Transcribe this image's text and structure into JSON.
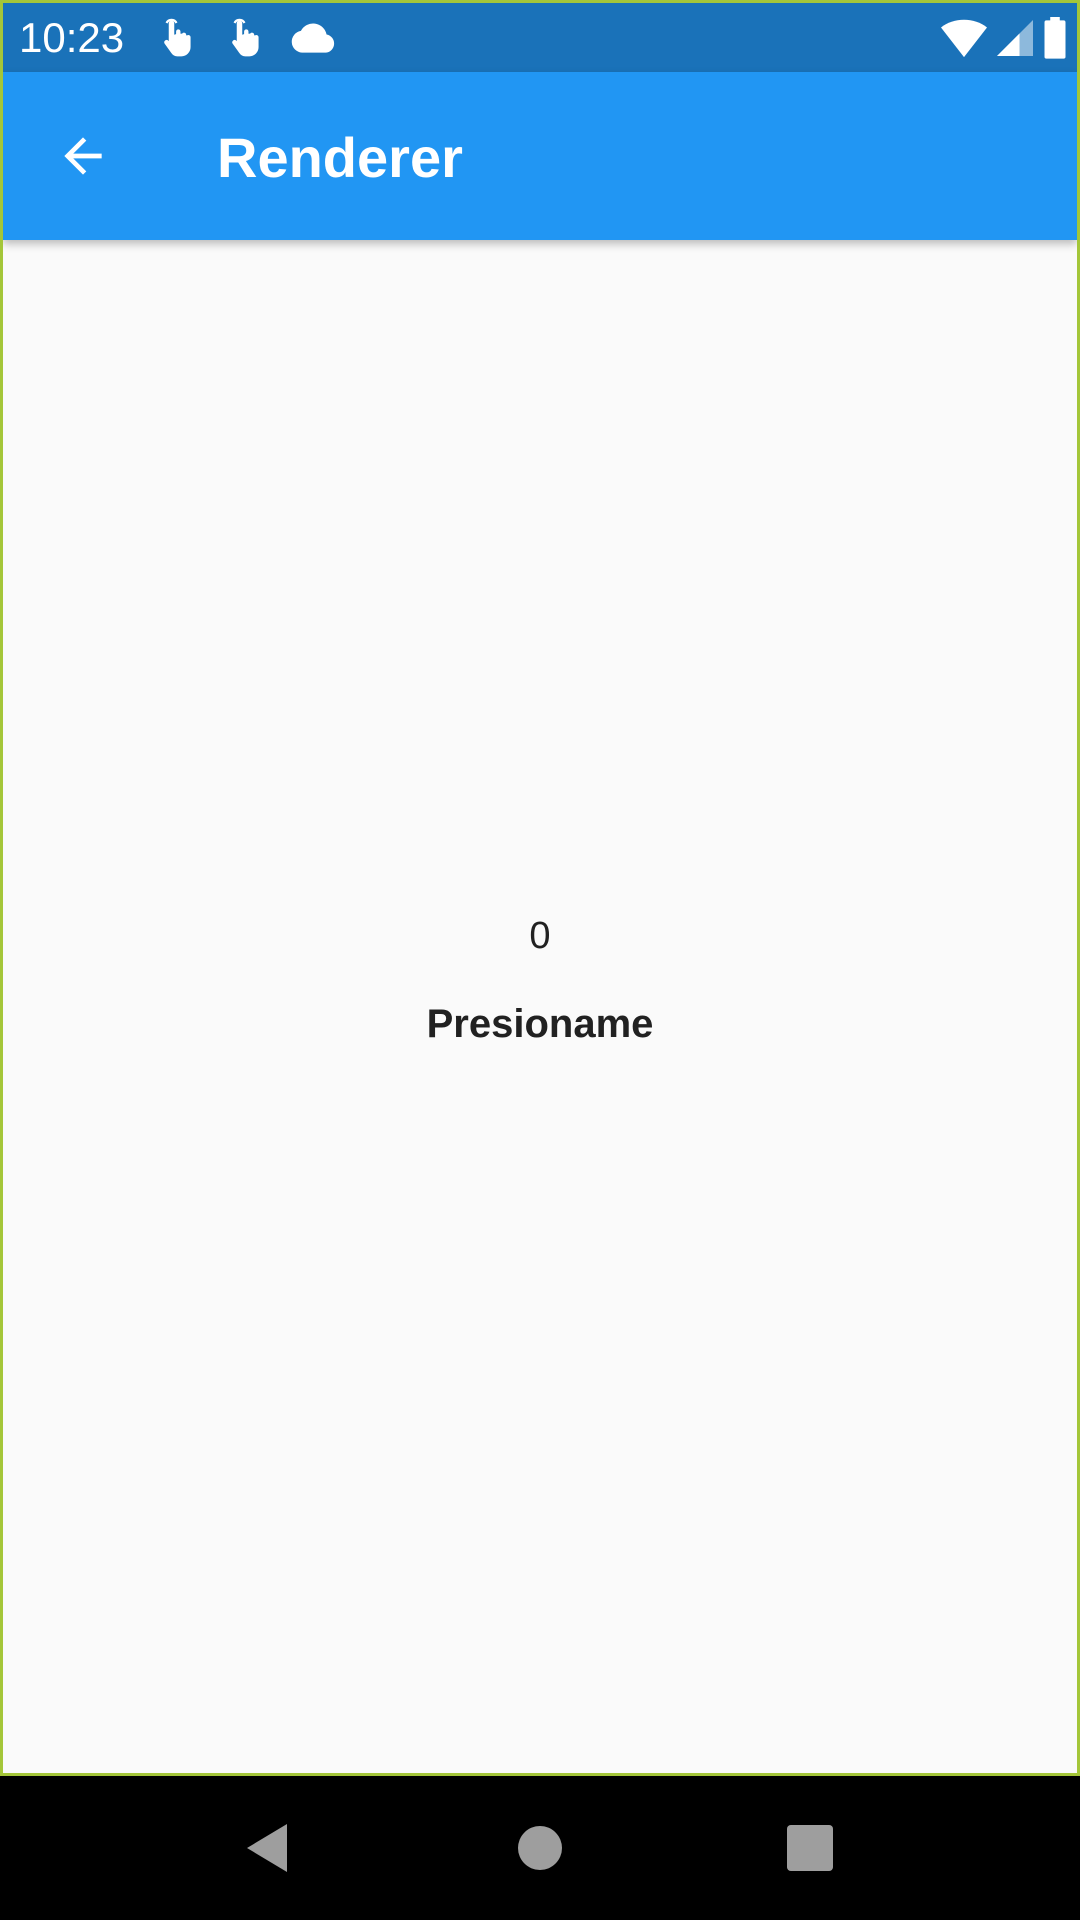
{
  "status_bar": {
    "time": "10:23",
    "icons_left": [
      "touch-icon",
      "touch-icon",
      "cloud-icon"
    ],
    "icons_right": [
      "wifi-icon",
      "signal-icon",
      "battery-icon"
    ]
  },
  "app_bar": {
    "title": "Renderer",
    "back_icon": "arrow-back-icon",
    "background_color": "#2196f3"
  },
  "content": {
    "counter_value": "0",
    "button_label": "Presioname"
  },
  "nav_bar": {
    "buttons": [
      "back-triangle-icon",
      "home-circle-icon",
      "recents-square-icon"
    ]
  },
  "colors": {
    "status_bar": "#1a72b9",
    "app_bar": "#2196f3",
    "background": "#fafafa",
    "text": "#212121",
    "frame_border": "#a4c639"
  }
}
